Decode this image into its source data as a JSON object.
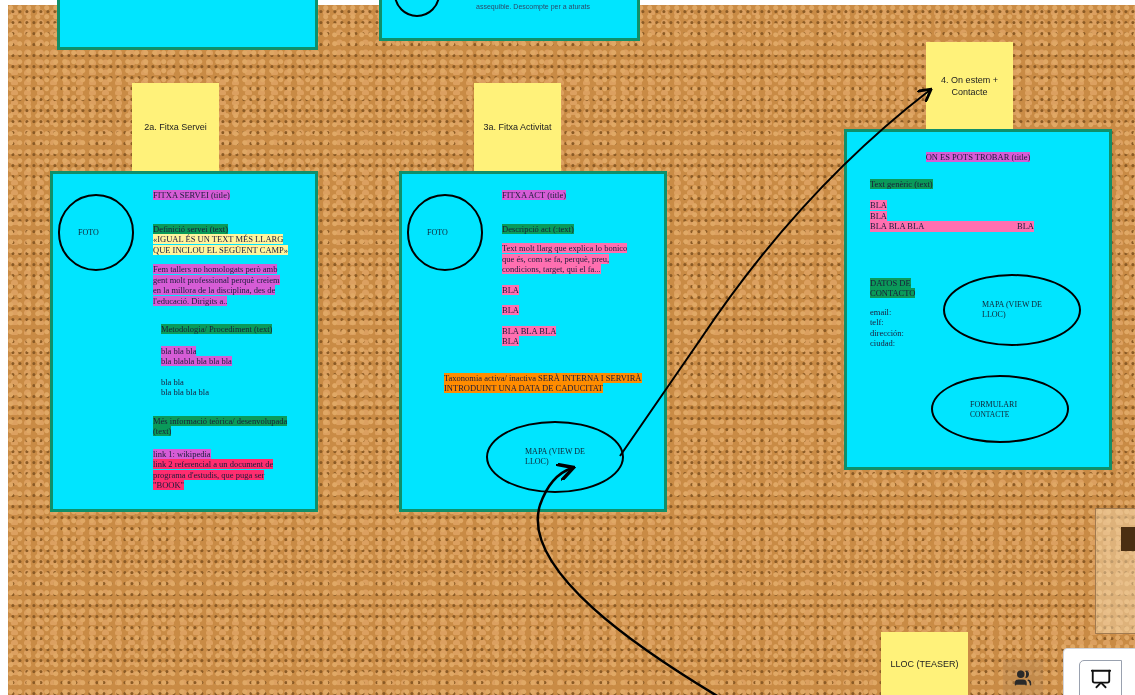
{
  "top_card_text": "assequible. Descompte per a aturats",
  "stickies": [
    {
      "text": "2a. Fitxa Servei"
    },
    {
      "text": "3a. Fitxa Activitat"
    },
    {
      "text": "4. On estem + Contacte"
    },
    {
      "text": "LLOC (TEASER)"
    }
  ],
  "cards": [
    {
      "shapes": [
        {
          "kind": "circle",
          "label": "FOTO"
        }
      ],
      "blocks": [
        {
          "kind": "normal",
          "lines": [
            {
              "text": "FITXA SERVEI (title)",
              "color": "#d65cd6"
            }
          ]
        },
        {
          "kind": "normal",
          "lines": [
            {
              "text": "Definició servei (text)",
              "color": "#0a9a5a"
            },
            {
              "text": "«IGUAL ÉS UN TEXT MÉS LLARG",
              "color": "#fff59d"
            },
            {
              "text": "QUE INCLOU EL SEGÜENT CAMP»",
              "color": "#fff59d"
            }
          ]
        },
        {
          "kind": "normal",
          "lines": [
            {
              "text": "Fem tallers no homologats però amb",
              "color": "#d65cd6"
            },
            {
              "text": "gent molt professional perquè creiem",
              "color": "#d65cd6"
            },
            {
              "text": "en la millora de la disciplina, des de",
              "color": "#d65cd6"
            },
            {
              "text": "l'educació. Dirigits a..",
              "color": "#d65cd6"
            }
          ]
        },
        {
          "kind": "indented",
          "lines": [
            {
              "text": "Metodologia/ Procediment (text)",
              "color": "#0a9a5a"
            }
          ]
        },
        {
          "kind": "indented",
          "lines": [
            {
              "text": "bla bla bla",
              "color": "#d65cd6"
            },
            {
              "text": "bla blabla bla bla bla",
              "color": "#d65cd6"
            }
          ]
        },
        {
          "kind": "indented",
          "lines": [
            {
              "text": "bla bla"
            },
            {
              "text": "bla bla bla bla"
            }
          ]
        },
        {
          "kind": "normal",
          "lines": [
            {
              "text": "Més informació teòrica/ desenvolupada",
              "color": "#0a9a5a"
            },
            {
              "text": "(text)",
              "color": "#0a9a5a"
            }
          ]
        },
        {
          "kind": "normal",
          "lines": [
            {
              "text": "link 1: wikipedia",
              "color": "#d65cd6"
            },
            {
              "text": "link 2 referencial a un document de",
              "color": "#ff2d6f"
            },
            {
              "text": "programa d'estudis, que puga ser",
              "color": "#ff2d6f"
            },
            {
              "text": "\"BOOK\"",
              "color": "#ff2d6f"
            }
          ]
        }
      ]
    },
    {
      "shapes": [
        {
          "kind": "circle",
          "label": "FOTO"
        },
        {
          "kind": "ellipse",
          "label": "MAPA (VIEW DE LLOC)"
        }
      ],
      "blocks": [
        {
          "kind": "normal",
          "lines": [
            {
              "text": "FITXA  ACT (title)",
              "color": "#d65cd6"
            }
          ]
        },
        {
          "kind": "normal",
          "lines": [
            {
              "text": "Descripció act (:text)",
              "color": "#0a9a5a"
            }
          ]
        },
        {
          "kind": "normal",
          "lines": [
            {
              "text": "Text molt llarg que explica lo bonico",
              "color": "#ff6fb0"
            },
            {
              "text": "que és, com se fa, perquè, preu,",
              "color": "#ff6fb0"
            },
            {
              "text": "condicions, target, qui el fa...",
              "color": "#ff6fb0"
            }
          ]
        },
        {
          "kind": "normal",
          "lines": [
            {
              "text": "BLA",
              "color": "#ff6fb0"
            }
          ]
        },
        {
          "kind": "normal",
          "lines": [
            {
              "text": "BLA",
              "color": "#ff6fb0"
            }
          ]
        },
        {
          "kind": "normal",
          "lines": [
            {
              "text": "BLA BLA BLA",
              "color": "#ff6fb0"
            },
            {
              "text": "BLA",
              "color": "#ff6fb0"
            }
          ]
        },
        {
          "kind": "wide",
          "lines": [
            {
              "text": "Taxonomia activa/ inactiva  SERÀ INTERNA I SERVIRÀ",
              "color": "#ff8c00"
            },
            {
              "text": "INTRODUINT UNA DATA DE CADUCITAT",
              "color": "#ff8c00"
            }
          ]
        }
      ]
    },
    {
      "shapes": [
        {
          "kind": "ellipse",
          "label": "MAPA (VIEW DE LLOC)"
        },
        {
          "kind": "ellipse",
          "label": "FORMULARI",
          "sublabel": "CONTACTE"
        }
      ],
      "blocks": [
        {
          "kind": "centered",
          "lines": [
            {
              "text": "ON ES POTS TROBAR  (title)",
              "color": "#d65cd6"
            }
          ]
        },
        {
          "kind": "left",
          "lines": [
            {
              "text": "Text genèric (text)",
              "color": "#0a9a5a"
            }
          ]
        },
        {
          "kind": "left",
          "lines": [
            {
              "text": "BLA",
              "color": "#ff6fb0"
            },
            {
              "text": "BLA",
              "color": "#ff6fb0"
            },
            {
              "text": "BLA BLA BLA",
              "trailing": "BLA",
              "color": "#ff6fb0"
            }
          ]
        },
        {
          "kind": "left",
          "lines": [
            {
              "text": "DATOS DE",
              "color": "#0a9a5a"
            },
            {
              "text": "CONTACTO",
              "color": "#0a9a5a"
            }
          ]
        },
        {
          "kind": "left",
          "lines": [
            {
              "text": "email:"
            },
            {
              "text": "telf:"
            },
            {
              "text": "dirección:"
            },
            {
              "text": "ciudad:"
            }
          ]
        }
      ]
    }
  ]
}
